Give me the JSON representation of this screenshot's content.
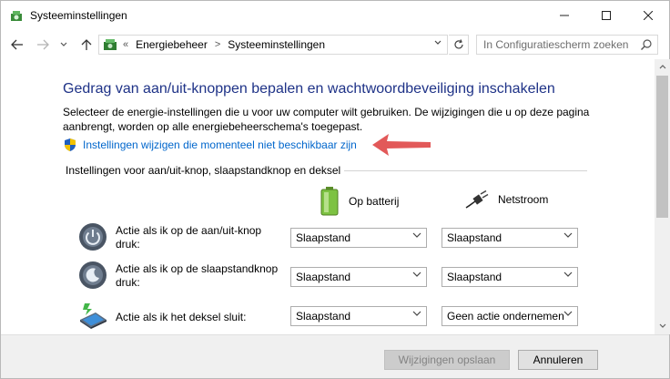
{
  "window": {
    "title": "Systeeminstellingen"
  },
  "address": {
    "overflow": "«",
    "segments": [
      "Energiebeheer",
      "Systeeminstellingen"
    ],
    "search_placeholder": "In Configuratiescherm zoeken"
  },
  "main": {
    "heading": "Gedrag van aan/uit-knoppen bepalen en wachtwoordbeveiliging inschakelen",
    "description": "Selecteer de energie-instellingen die u voor uw computer wilt gebruiken. De wijzigingen die u op deze pagina aanbrengt, worden op alle energiebeheerschema's toegepast.",
    "change_link": "Instellingen wijzigen die momenteel niet beschikbaar zijn",
    "section_title": "Instellingen voor aan/uit-knop, slaapstandknop en deksel",
    "columns": {
      "battery": "Op batterij",
      "plugged_in": "Netstroom"
    },
    "rows": [
      {
        "label": "Actie als ik op de aan/uit-knop druk:",
        "battery": "Slaapstand",
        "plugged_in": "Slaapstand"
      },
      {
        "label": "Actie als ik op de slaapstandknop druk:",
        "battery": "Slaapstand",
        "plugged_in": "Slaapstand"
      },
      {
        "label": "Actie als ik het deksel sluit:",
        "battery": "Slaapstand",
        "plugged_in": "Geen actie ondernemen"
      }
    ]
  },
  "footer": {
    "save_label": "Wijzigingen opslaan",
    "cancel_label": "Annuleren"
  },
  "colors": {
    "heading": "#1e3287",
    "link": "#0066cc",
    "annotation_arrow": "#e04b4b"
  },
  "icons": [
    "app-icon",
    "back-icon",
    "forward-icon",
    "recent-dropdown-icon",
    "up-icon",
    "control-panel-icon",
    "refresh-icon",
    "search-icon",
    "shield-icon",
    "battery-icon",
    "plug-icon",
    "power-button-icon",
    "sleep-button-icon",
    "laptop-lid-icon"
  ]
}
